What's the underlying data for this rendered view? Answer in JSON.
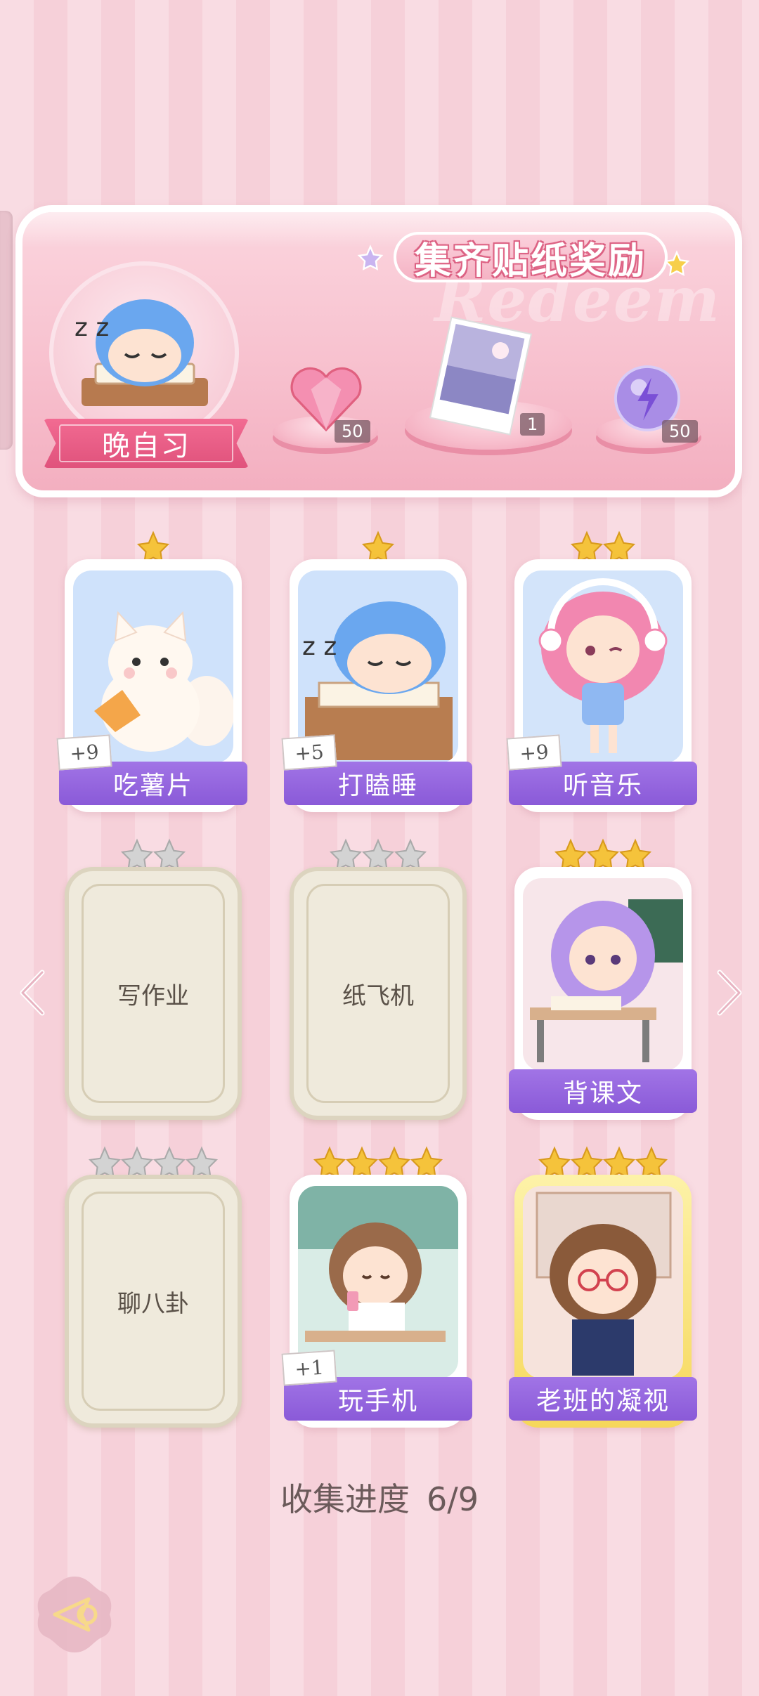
{
  "banner": {
    "title": "集齐贴纸奖励",
    "ghost_text": "Redeem",
    "portrait_label": "晚自习",
    "rewards": [
      {
        "icon": "heart-gem-icon",
        "count": "50"
      },
      {
        "icon": "photo-card-icon",
        "count": "1"
      },
      {
        "icon": "energy-orb-icon",
        "count": "50"
      }
    ]
  },
  "cards": [
    {
      "label": "吃薯片",
      "stars": 1,
      "unlocked": true,
      "bonus": "+9",
      "art": "cat"
    },
    {
      "label": "打瞌睡",
      "stars": 1,
      "unlocked": true,
      "bonus": "+5",
      "art": "sleepy-boy"
    },
    {
      "label": "听音乐",
      "stars": 2,
      "unlocked": true,
      "bonus": "+9",
      "art": "music-girl"
    },
    {
      "label": "写作业",
      "stars": 2,
      "unlocked": false
    },
    {
      "label": "纸飞机",
      "stars": 3,
      "unlocked": false
    },
    {
      "label": "背课文",
      "stars": 3,
      "unlocked": true,
      "art": "study-girl"
    },
    {
      "label": "聊八卦",
      "stars": 4,
      "unlocked": false
    },
    {
      "label": "玩手机",
      "stars": 4,
      "unlocked": true,
      "bonus": "+1",
      "art": "phone-girl"
    },
    {
      "label": "老班的凝视",
      "stars": 4,
      "unlocked": true,
      "art": "teacher"
    }
  ],
  "progress": {
    "label": "收集进度",
    "value": "6/9"
  },
  "colors": {
    "label_purple": "#8a5ad8",
    "ribbon_pink": "#e0527c",
    "gold_star": "#f5c33b",
    "grey_star": "#c9c9c9"
  }
}
